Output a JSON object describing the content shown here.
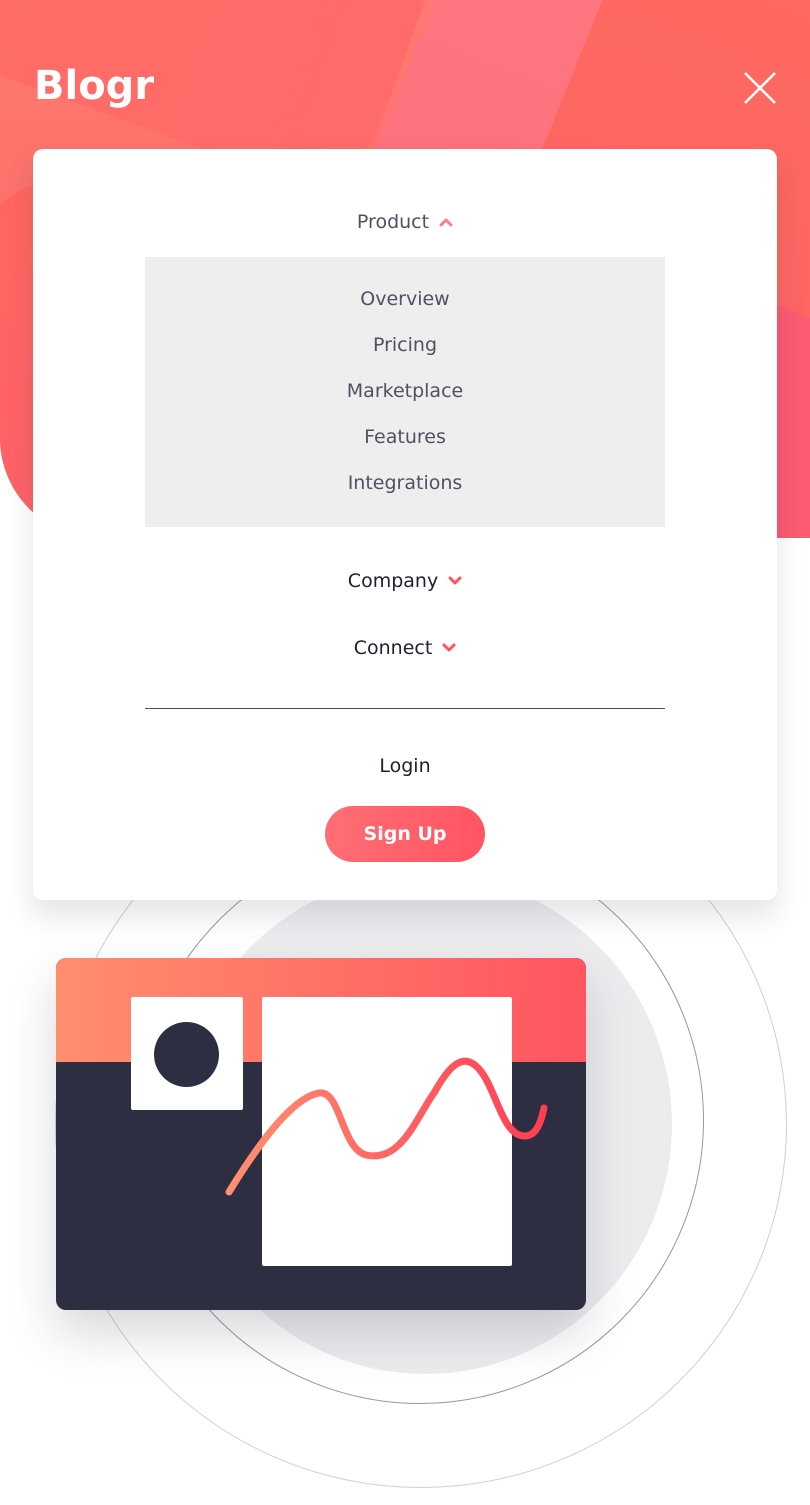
{
  "header": {
    "logo_text": "Blogr",
    "close_icon": "close-icon"
  },
  "menu": {
    "product": {
      "label": "Product",
      "expanded": true,
      "icon": "chevron-up-icon",
      "items": [
        {
          "label": "Overview"
        },
        {
          "label": "Pricing"
        },
        {
          "label": "Marketplace"
        },
        {
          "label": "Features"
        },
        {
          "label": "Integrations"
        }
      ]
    },
    "company": {
      "label": "Company",
      "expanded": false,
      "icon": "chevron-down-icon"
    },
    "connect": {
      "label": "Connect",
      "expanded": false,
      "icon": "chevron-down-icon"
    },
    "login_label": "Login",
    "signup_label": "Sign Up"
  },
  "colors": {
    "accent": "#ff525d",
    "gradient_start": "#ff8f70",
    "gradient_end": "#ff3d54",
    "dark_navy": "#2d2e41",
    "submenu_bg": "#eeeeee",
    "heading_text": "#202131",
    "muted_text": "#4f5061"
  }
}
